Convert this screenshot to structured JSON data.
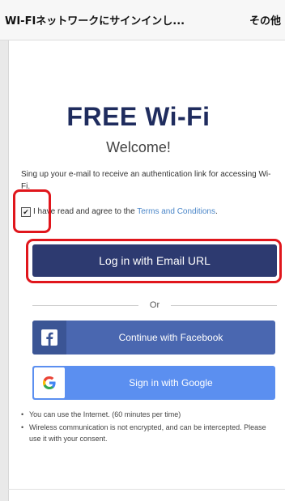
{
  "topbar": {
    "title": "WI-FIネットワークにサインインし...",
    "other": "その他"
  },
  "portal": {
    "heading": "FREE Wi-Fi",
    "welcome": "Welcome!",
    "description": "Sing up your e-mail to receive an authentication link for accessing Wi-Fi.",
    "agree_text": "I have read and agree to the ",
    "terms_link": "Terms and Conditions",
    "agree_end": ".",
    "checkbox_checked": true
  },
  "buttons": {
    "email": "Log in with Email URL",
    "or": "Or",
    "facebook": "Continue with Facebook",
    "google": "Sign in with Google"
  },
  "notes": [
    "You can use the Internet. (60 minutes per time)",
    "Wireless communication is not encrypted, and can be intercepted. Please use it with your consent."
  ],
  "colors": {
    "heading": "#1f2c5e",
    "email_button": "#2d3a70",
    "facebook_button": "#4a67b0",
    "google_button": "#5b8ff0",
    "highlight": "#e0161c",
    "link": "#4a86c8"
  },
  "icons": {
    "facebook": "facebook-logo-icon",
    "google": "google-logo-icon",
    "checkbox": "checkbox-checked-icon"
  }
}
